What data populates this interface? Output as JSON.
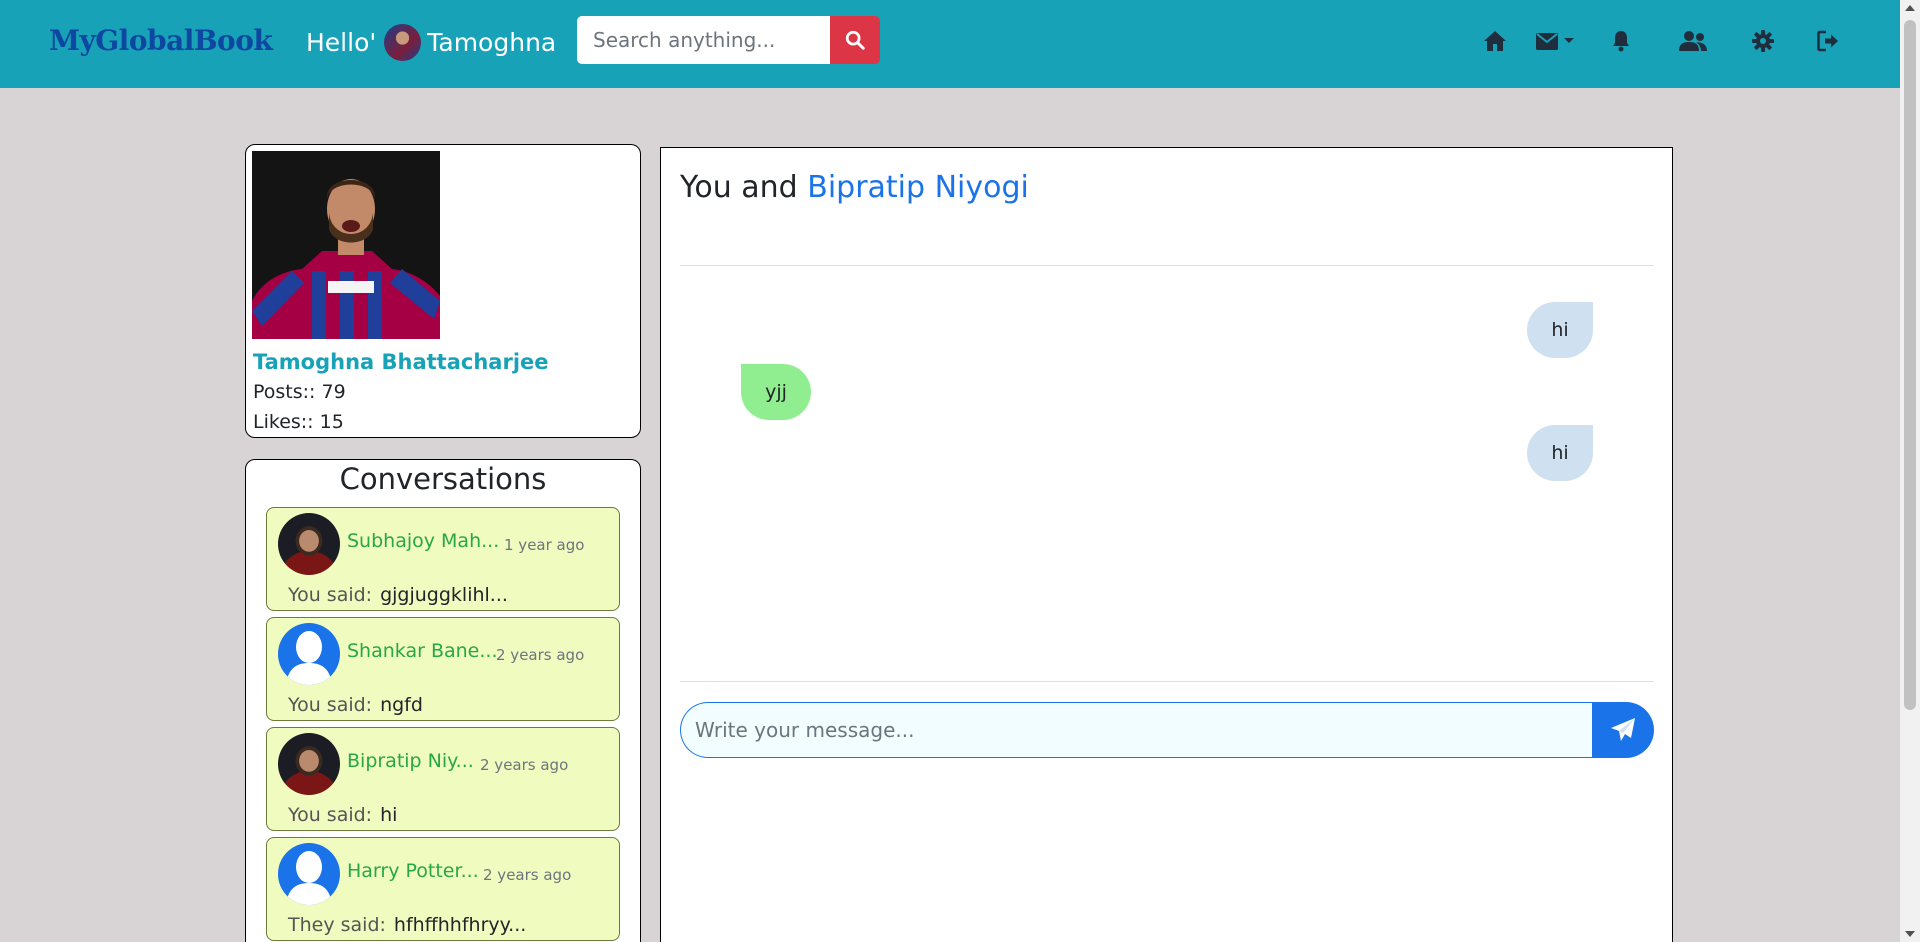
{
  "navbar": {
    "brand": "MyGlobalBook",
    "greeting": "Hello'",
    "user_first_name": "Tamoghna",
    "search": {
      "placeholder": "Search anything..."
    },
    "icons": [
      "home-icon",
      "mail-icon",
      "bell-icon",
      "users-icon",
      "gear-icon",
      "logout-icon"
    ],
    "bg_color": "#17a2b8",
    "search_button_color": "#dc3545"
  },
  "profile": {
    "name": "Tamoghna Bhattacharjee",
    "posts_label": "Posts::",
    "posts": "79",
    "likes_label": "Likes::",
    "likes": "15"
  },
  "conversations": {
    "title": "Conversations",
    "items": [
      {
        "name": "Subhajoy Mah...",
        "time": "1 year ago",
        "who": "You said:",
        "message": "gjgjuggklihl...",
        "avatar": "photo"
      },
      {
        "name": "Shankar Bane...",
        "time": "2 years ago",
        "who": "You said:",
        "message": "ngfd",
        "avatar": "blank"
      },
      {
        "name": "Bipratip Niy...",
        "time": "2 years ago",
        "who": "You said:",
        "message": "hi",
        "avatar": "photo"
      },
      {
        "name": "Harry Potter...",
        "time": "2 years ago",
        "who": "They said:",
        "message": "hfhffhhfhryy...",
        "avatar": "blank"
      }
    ]
  },
  "chat": {
    "prefix": "You and",
    "partner": "Bipratip Niyogi",
    "messages": [
      {
        "text": "hi",
        "side": "sent"
      },
      {
        "text": "yjj",
        "side": "received"
      },
      {
        "text": "hi",
        "side": "sent"
      }
    ],
    "input_placeholder": "Write your message...",
    "sent_color": "#cfe0f1",
    "received_color": "#90ee90",
    "accent": "#1a73e8"
  }
}
